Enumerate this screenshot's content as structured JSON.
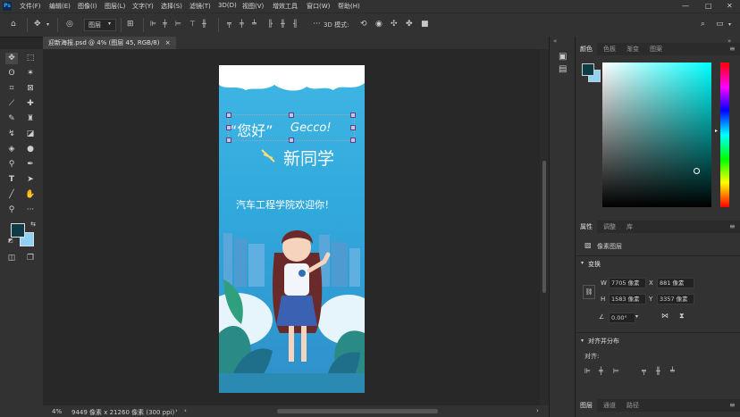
{
  "app": {
    "logo": "Ps"
  },
  "menu": [
    "文件(F)",
    "编辑(E)",
    "图像(I)",
    "图层(L)",
    "文字(Y)",
    "选择(S)",
    "滤镜(T)",
    "3D(D)",
    "视图(V)",
    "增效工具",
    "窗口(W)",
    "帮助(H)"
  ],
  "window_controls": {
    "minimize": "—",
    "maximize": "□",
    "close": "✕"
  },
  "options": {
    "layer_select": "图层",
    "mode_3d_label": "3D 模式:"
  },
  "document_tab": {
    "title": "迎新海报.psd @ 4% (图层 45, RGB/8)",
    "close": "×"
  },
  "poster": {
    "greeting": "“您好”",
    "name": "Gecco!",
    "subtitle": "新同学",
    "welcome": "汽车工程学院欢迎你！"
  },
  "status": {
    "zoom": "4%",
    "doc_size": "9449 像素 x 21260 像素 (300 ppi)"
  },
  "color_panel": {
    "tabs": [
      "颜色",
      "色板",
      "渐变",
      "图案"
    ],
    "active_tab": 0
  },
  "properties_panel": {
    "tabs": [
      "属性",
      "调整",
      "库"
    ],
    "active_tab": 0,
    "layer_type": "像素图层",
    "transform_title": "变换",
    "w_label": "W",
    "w_value": "7705 像素",
    "x_label": "X",
    "x_value": "881 像素",
    "h_label": "H",
    "h_value": "1583 像素",
    "y_label": "Y",
    "y_value": "3357 像素",
    "angle_value": "0.00°",
    "align_title": "对齐并分布",
    "align_label": "对齐:"
  },
  "layers_panel": {
    "tabs": [
      "图层",
      "通道",
      "路径"
    ],
    "active_tab": 0
  },
  "colors": {
    "foreground": "#0e3c46",
    "background": "#8fd3f4",
    "accent": "#31a8ff"
  }
}
